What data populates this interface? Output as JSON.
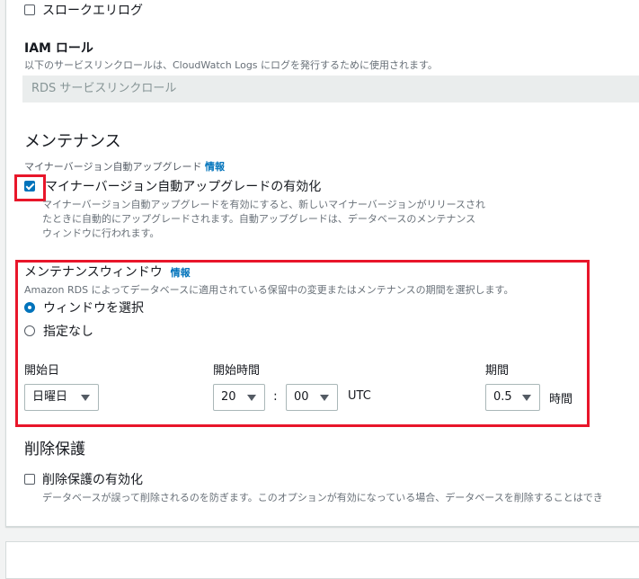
{
  "slow_query_log": {
    "label": "スロークエリログ",
    "checked": false
  },
  "iam_role": {
    "title": "IAM ロール",
    "description": "以下のサービスリンクロールは、CloudWatch Logs にログを発行するために使用されます。",
    "value": "RDS サービスリンクロール"
  },
  "maintenance": {
    "section_title": "メンテナンス",
    "auto_upgrade": {
      "caption": "マイナーバージョン自動アップグレード",
      "info": "情報",
      "checkbox_label": "マイナーバージョン自動アップグレードの有効化",
      "checked": true,
      "description_lines": [
        "マイナーバージョン自動アップグレードを有効にすると、新しいマイナーバージョンがリリースされ",
        "たときに自動的にアップグレードされます。自動アップグレードは、データベースのメンテナンス",
        "ウィンドウに行われます。"
      ]
    },
    "window": {
      "title": "メンテナンスウィンドウ",
      "info": "情報",
      "description": "Amazon RDS によってデータベースに適用されている保留中の変更またはメンテナンスの期間を選択します。",
      "options": [
        {
          "label": "ウィンドウを選択",
          "selected": true
        },
        {
          "label": "指定なし",
          "selected": false
        }
      ],
      "start_day": {
        "label": "開始日",
        "value": "日曜日"
      },
      "start_time": {
        "label": "開始時間",
        "hour": "20",
        "separator": ":",
        "minute": "00",
        "tz": "UTC"
      },
      "duration": {
        "label": "期間",
        "value": "0.5",
        "unit": "時間"
      }
    }
  },
  "deletion_protection": {
    "section_title": "削除保護",
    "checkbox_label": "削除保護の有効化",
    "checked": false,
    "description": "データベースが誤って削除されるのを防ぎます。このオプションが有効になっている場合、データベースを削除することはでき"
  },
  "colors": {
    "accent": "#0073bb",
    "highlight": "#e8162a"
  }
}
